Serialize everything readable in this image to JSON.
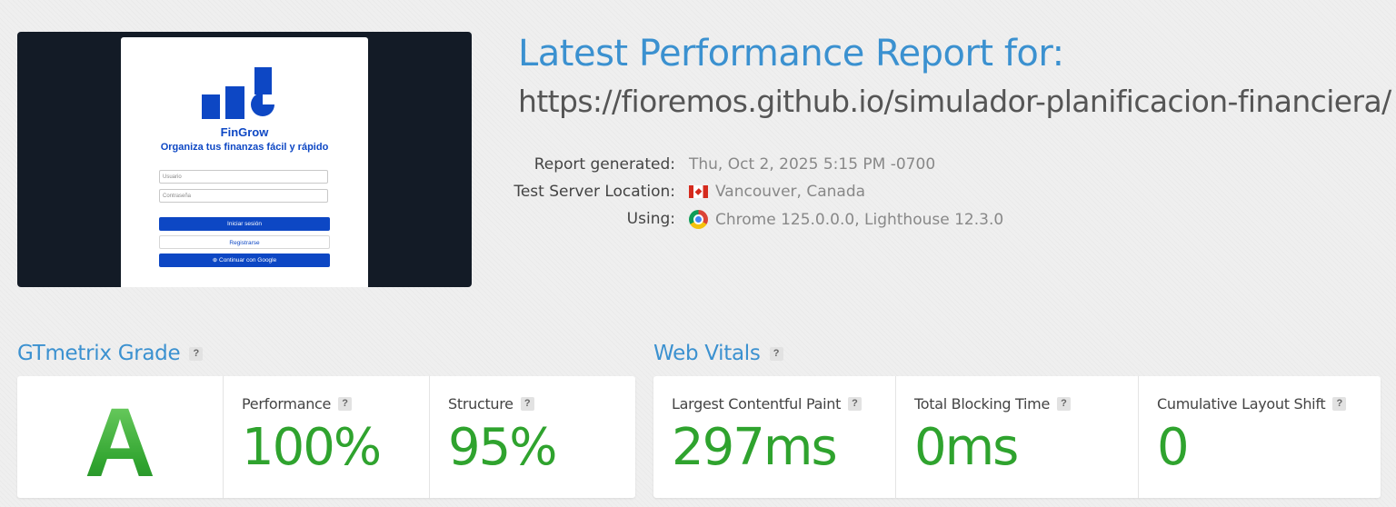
{
  "screenshot": {
    "brand": "FinGrow",
    "tagline": "Organiza tus finanzas fácil y rápido",
    "username_placeholder": "Usuario",
    "password_placeholder": "Contraseña",
    "login_label": "Iniciar sesión",
    "register_label": "Registrarse",
    "google_label": "Continuar con Google",
    "colors": {
      "frame": "#131b26",
      "brand": "#0d47c4"
    }
  },
  "report": {
    "title": "Latest Performance Report for:",
    "url": "https://fioremos.github.io/simulador-planificacion-financiera/",
    "meta": [
      {
        "label": "Report generated:",
        "value": "Thu, Oct 2, 2025 5:15 PM -0700",
        "icon": ""
      },
      {
        "label": "Test Server Location:",
        "value": "Vancouver, Canada",
        "icon": "canada-flag-icon"
      },
      {
        "label": "Using:",
        "value": "Chrome 125.0.0.0, Lighthouse 12.3.0",
        "icon": "chrome-icon"
      }
    ]
  },
  "grade_section": {
    "title": "GTmetrix Grade",
    "help": "?",
    "grade": "A",
    "performance": {
      "label": "Performance",
      "value": "100%"
    },
    "structure": {
      "label": "Structure",
      "value": "95%"
    }
  },
  "vitals_section": {
    "title": "Web Vitals",
    "help": "?",
    "metrics": [
      {
        "label": "Largest Contentful Paint",
        "value": "297ms"
      },
      {
        "label": "Total Blocking Time",
        "value": "0ms"
      },
      {
        "label": "Cumulative Layout Shift",
        "value": "0"
      }
    ]
  },
  "colors": {
    "accent": "#3b91d0",
    "good": "#2fa32e",
    "background": "#efefef"
  }
}
